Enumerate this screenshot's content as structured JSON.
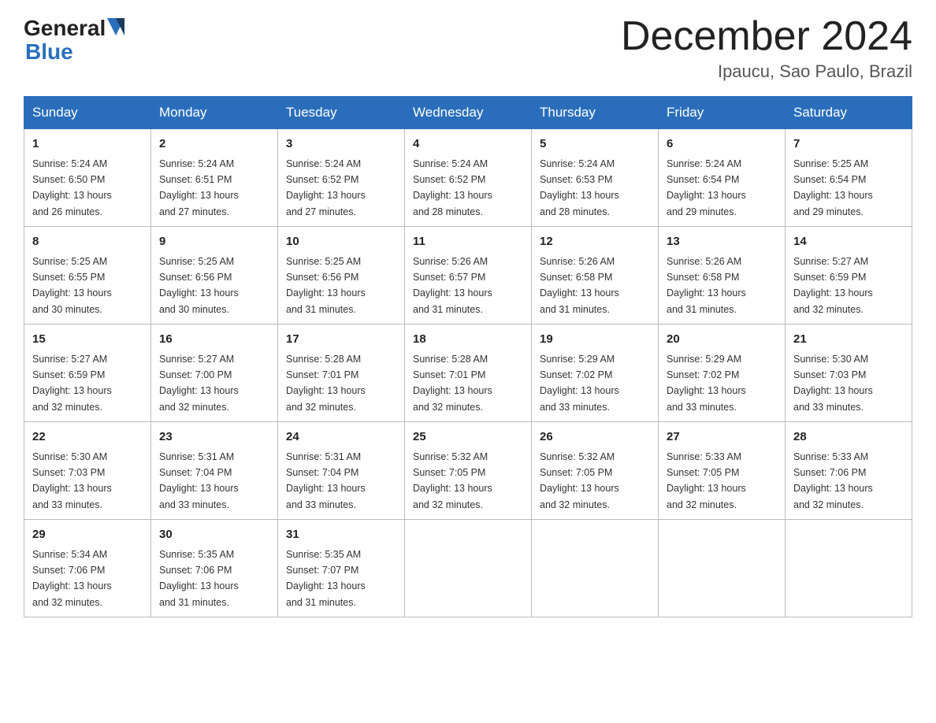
{
  "header": {
    "logo_general": "General",
    "logo_blue": "Blue",
    "title": "December 2024",
    "location": "Ipaucu, Sao Paulo, Brazil"
  },
  "days_of_week": [
    "Sunday",
    "Monday",
    "Tuesday",
    "Wednesday",
    "Thursday",
    "Friday",
    "Saturday"
  ],
  "weeks": [
    [
      {
        "day": "1",
        "sunrise": "5:24 AM",
        "sunset": "6:50 PM",
        "daylight": "13 hours and 26 minutes."
      },
      {
        "day": "2",
        "sunrise": "5:24 AM",
        "sunset": "6:51 PM",
        "daylight": "13 hours and 27 minutes."
      },
      {
        "day": "3",
        "sunrise": "5:24 AM",
        "sunset": "6:52 PM",
        "daylight": "13 hours and 27 minutes."
      },
      {
        "day": "4",
        "sunrise": "5:24 AM",
        "sunset": "6:52 PM",
        "daylight": "13 hours and 28 minutes."
      },
      {
        "day": "5",
        "sunrise": "5:24 AM",
        "sunset": "6:53 PM",
        "daylight": "13 hours and 28 minutes."
      },
      {
        "day": "6",
        "sunrise": "5:24 AM",
        "sunset": "6:54 PM",
        "daylight": "13 hours and 29 minutes."
      },
      {
        "day": "7",
        "sunrise": "5:25 AM",
        "sunset": "6:54 PM",
        "daylight": "13 hours and 29 minutes."
      }
    ],
    [
      {
        "day": "8",
        "sunrise": "5:25 AM",
        "sunset": "6:55 PM",
        "daylight": "13 hours and 30 minutes."
      },
      {
        "day": "9",
        "sunrise": "5:25 AM",
        "sunset": "6:56 PM",
        "daylight": "13 hours and 30 minutes."
      },
      {
        "day": "10",
        "sunrise": "5:25 AM",
        "sunset": "6:56 PM",
        "daylight": "13 hours and 31 minutes."
      },
      {
        "day": "11",
        "sunrise": "5:26 AM",
        "sunset": "6:57 PM",
        "daylight": "13 hours and 31 minutes."
      },
      {
        "day": "12",
        "sunrise": "5:26 AM",
        "sunset": "6:58 PM",
        "daylight": "13 hours and 31 minutes."
      },
      {
        "day": "13",
        "sunrise": "5:26 AM",
        "sunset": "6:58 PM",
        "daylight": "13 hours and 31 minutes."
      },
      {
        "day": "14",
        "sunrise": "5:27 AM",
        "sunset": "6:59 PM",
        "daylight": "13 hours and 32 minutes."
      }
    ],
    [
      {
        "day": "15",
        "sunrise": "5:27 AM",
        "sunset": "6:59 PM",
        "daylight": "13 hours and 32 minutes."
      },
      {
        "day": "16",
        "sunrise": "5:27 AM",
        "sunset": "7:00 PM",
        "daylight": "13 hours and 32 minutes."
      },
      {
        "day": "17",
        "sunrise": "5:28 AM",
        "sunset": "7:01 PM",
        "daylight": "13 hours and 32 minutes."
      },
      {
        "day": "18",
        "sunrise": "5:28 AM",
        "sunset": "7:01 PM",
        "daylight": "13 hours and 32 minutes."
      },
      {
        "day": "19",
        "sunrise": "5:29 AM",
        "sunset": "7:02 PM",
        "daylight": "13 hours and 33 minutes."
      },
      {
        "day": "20",
        "sunrise": "5:29 AM",
        "sunset": "7:02 PM",
        "daylight": "13 hours and 33 minutes."
      },
      {
        "day": "21",
        "sunrise": "5:30 AM",
        "sunset": "7:03 PM",
        "daylight": "13 hours and 33 minutes."
      }
    ],
    [
      {
        "day": "22",
        "sunrise": "5:30 AM",
        "sunset": "7:03 PM",
        "daylight": "13 hours and 33 minutes."
      },
      {
        "day": "23",
        "sunrise": "5:31 AM",
        "sunset": "7:04 PM",
        "daylight": "13 hours and 33 minutes."
      },
      {
        "day": "24",
        "sunrise": "5:31 AM",
        "sunset": "7:04 PM",
        "daylight": "13 hours and 33 minutes."
      },
      {
        "day": "25",
        "sunrise": "5:32 AM",
        "sunset": "7:05 PM",
        "daylight": "13 hours and 32 minutes."
      },
      {
        "day": "26",
        "sunrise": "5:32 AM",
        "sunset": "7:05 PM",
        "daylight": "13 hours and 32 minutes."
      },
      {
        "day": "27",
        "sunrise": "5:33 AM",
        "sunset": "7:05 PM",
        "daylight": "13 hours and 32 minutes."
      },
      {
        "day": "28",
        "sunrise": "5:33 AM",
        "sunset": "7:06 PM",
        "daylight": "13 hours and 32 minutes."
      }
    ],
    [
      {
        "day": "29",
        "sunrise": "5:34 AM",
        "sunset": "7:06 PM",
        "daylight": "13 hours and 32 minutes."
      },
      {
        "day": "30",
        "sunrise": "5:35 AM",
        "sunset": "7:06 PM",
        "daylight": "13 hours and 31 minutes."
      },
      {
        "day": "31",
        "sunrise": "5:35 AM",
        "sunset": "7:07 PM",
        "daylight": "13 hours and 31 minutes."
      },
      null,
      null,
      null,
      null
    ]
  ],
  "labels": {
    "sunrise": "Sunrise:",
    "sunset": "Sunset:",
    "daylight": "Daylight:"
  }
}
